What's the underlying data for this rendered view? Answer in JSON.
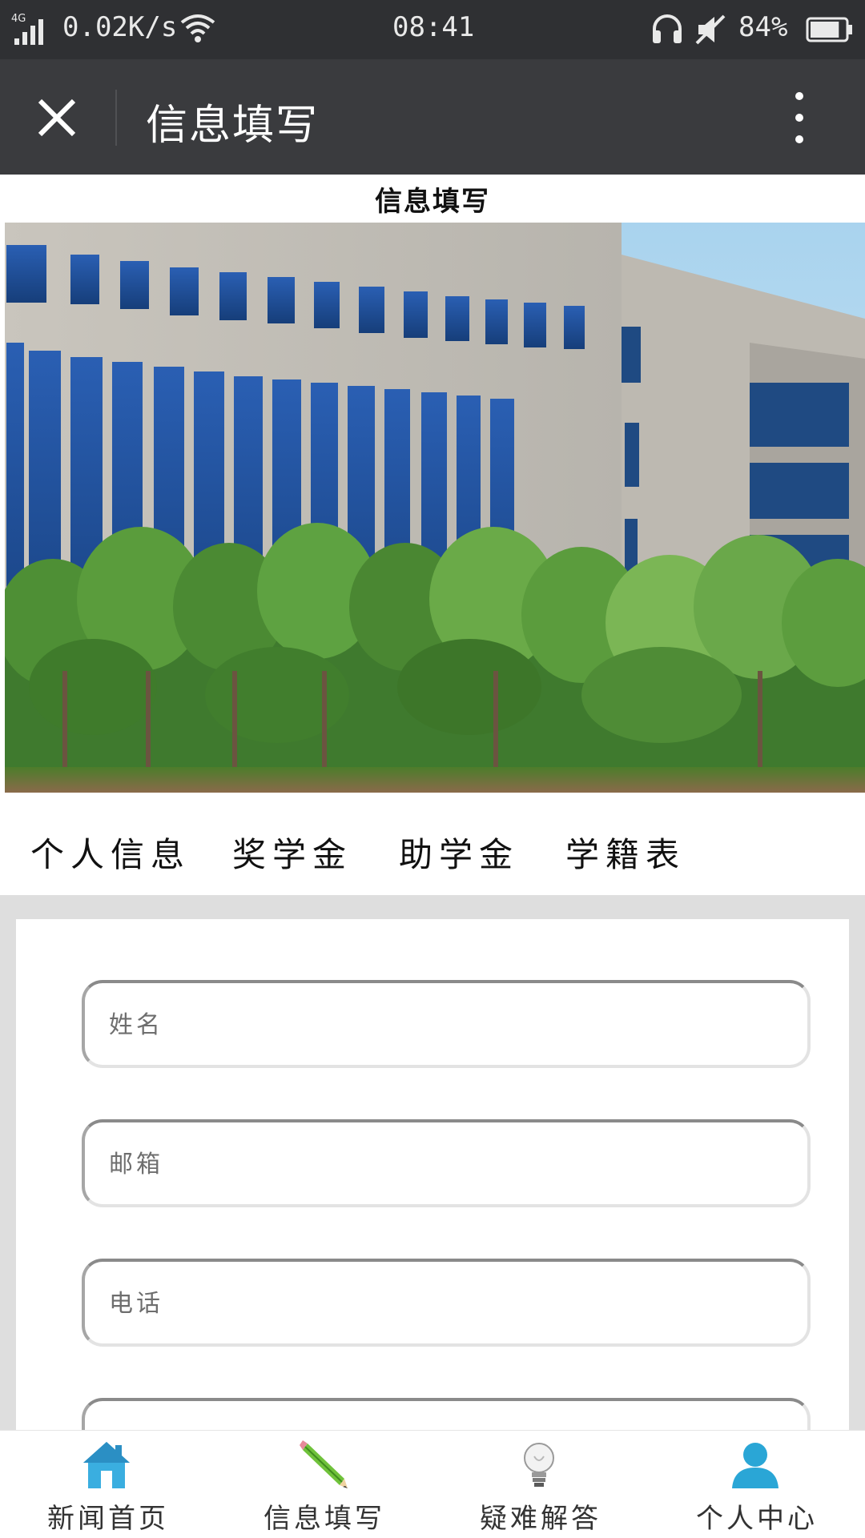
{
  "status_bar": {
    "network_type": "4G",
    "net_speed": "0.02K/s",
    "time": "08:41",
    "battery_percent": "84%",
    "battery_level": 0.84
  },
  "header": {
    "title": "信息填写",
    "close_icon": "close-icon",
    "more_icon": "more-vertical-icon"
  },
  "page": {
    "heading": "信息填写"
  },
  "tabs": [
    {
      "label": "个人信息"
    },
    {
      "label": "奖学金"
    },
    {
      "label": "助学金"
    },
    {
      "label": "学籍表"
    }
  ],
  "form": {
    "name_placeholder": "姓名",
    "email_placeholder": "邮箱",
    "phone_placeholder": "电话",
    "fourth_placeholder": ""
  },
  "bottom_nav": [
    {
      "label": "新闻首页",
      "icon": "home-icon"
    },
    {
      "label": "信息填写",
      "icon": "pencil-icon"
    },
    {
      "label": "疑难解答",
      "icon": "lightbulb-icon"
    },
    {
      "label": "个人中心",
      "icon": "person-icon"
    }
  ]
}
